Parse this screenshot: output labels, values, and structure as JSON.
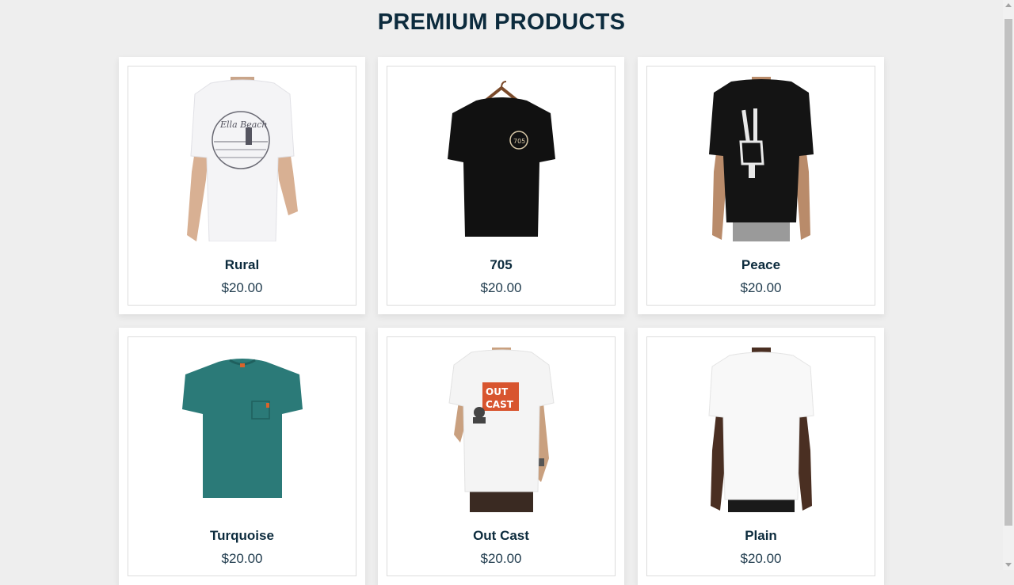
{
  "header": {
    "title": "PREMIUM PRODUCTS"
  },
  "products": [
    {
      "name": "Rural",
      "price": "$20.00",
      "image": "white-tshirt-back-print-image",
      "shirt_color": "#f4f4f6"
    },
    {
      "name": "705",
      "price": "$20.00",
      "image": "black-tshirt-on-hanger-image",
      "shirt_color": "#111111"
    },
    {
      "name": "Peace",
      "price": "$20.00",
      "image": "black-tshirt-skeleton-hand-image",
      "shirt_color": "#141414"
    },
    {
      "name": "Turquoise",
      "price": "$20.00",
      "image": "teal-pocket-tshirt-image",
      "shirt_color": "#2b7a78"
    },
    {
      "name": "Out Cast",
      "price": "$20.00",
      "image": "white-tshirt-outcast-print-image",
      "shirt_color": "#f4f4f4"
    },
    {
      "name": "Plain",
      "price": "$20.00",
      "image": "plain-white-tshirt-image",
      "shirt_color": "#f8f8f8"
    }
  ]
}
